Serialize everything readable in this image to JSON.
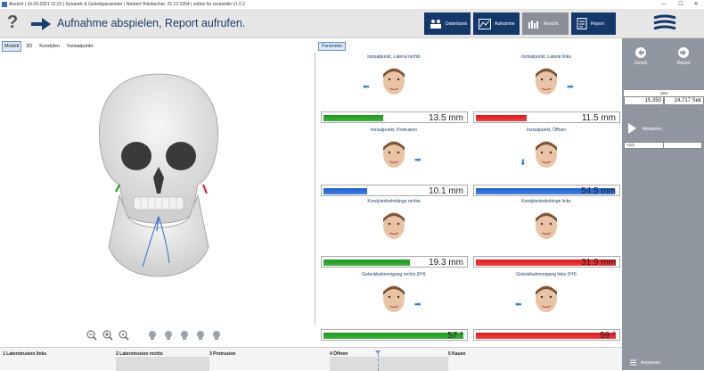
{
  "window": {
    "title": "Ansicht | 16.09.2021 12:22 | Dynamik & Gelenkparameter | Norbert Holzbecher, 21.12.1954 | zebris for cerasmile v1.0.2",
    "controls": [
      "—",
      "☐",
      "✕"
    ]
  },
  "header": {
    "help": "?",
    "instruction": "Aufnahme abspielen, Report aufrufen.",
    "buttons": [
      {
        "label": "Datenbank",
        "icon": "people-icon",
        "active": false
      },
      {
        "label": "Aufnahme",
        "icon": "recording-chart-icon",
        "active": false
      },
      {
        "label": "Ansicht",
        "icon": "bar-chart-icon",
        "active": true
      },
      {
        "label": "Report",
        "icon": "report-document-icon",
        "active": false
      }
    ]
  },
  "view_tabs": [
    {
      "label": "Modell",
      "active": true
    },
    {
      "label": "3D",
      "active": false
    },
    {
      "label": "Kondylen",
      "active": false
    },
    {
      "label": "Inzisalpunkt",
      "active": false
    }
  ],
  "parameters_tab": "Parameter",
  "parameters": [
    {
      "title": "Inzisalpunkt, Lateral rechts",
      "value": "13.5 mm",
      "fraction": 0.42,
      "color": "#1a9a1a",
      "direction": "left"
    },
    {
      "title": "Inzisalpunkt, Lateral links",
      "value": "11.5 mm",
      "fraction": 0.36,
      "color": "#e01818",
      "direction": "right"
    },
    {
      "title": "Inzisalpunkt, Protrusion",
      "value": "10.1 mm",
      "fraction": 0.31,
      "color": "#1a5fd0",
      "direction": "right"
    },
    {
      "title": "Inzisalpunkt, Öffnen",
      "value": "54.5 mm",
      "fraction": 0.98,
      "color": "#1a5fd0",
      "direction": "down"
    },
    {
      "title": "Kondylenbahnlänge rechts",
      "value": "19.3 mm",
      "fraction": 0.61,
      "color": "#1a9a1a",
      "direction": ""
    },
    {
      "title": "Kondylenbahnlänge links",
      "value": "31.9 mm",
      "fraction": 0.99,
      "color": "#e01818",
      "direction": ""
    },
    {
      "title": "Gelenkbahnneigung rechts (FH)",
      "value": "57 °",
      "fraction": 0.99,
      "color": "#1a9a1a",
      "direction": "right"
    },
    {
      "title": "Gelenkbahnneigung links (FH)",
      "value": "59 °",
      "fraction": 0.99,
      "color": "#e01818",
      "direction": "left"
    }
  ],
  "sidepanel": {
    "back_label": "Zurück",
    "report_label": "Report",
    "zeit_label": "Zeit",
    "time_current": "15,350",
    "time_total": "24,717 Sek",
    "play_label": "Abspielen",
    "speed_label": "×1/2",
    "anpassen_label": "Anpassen"
  },
  "timeline": [
    {
      "label": "1 Laterotrusion links"
    },
    {
      "label": "2 Laterotrusion rechts"
    },
    {
      "label": "3 Protrusion"
    },
    {
      "label": "4 Öffnen"
    },
    {
      "label": "5 Kauen"
    }
  ],
  "toolbar_icons": [
    "zoom-out-icon",
    "zoom-in-icon",
    "zoom-reset-icon",
    "head-view-right-icon",
    "head-view-front-icon",
    "head-view-left-icon",
    "head-view-top-icon",
    "head-view-back-icon"
  ]
}
